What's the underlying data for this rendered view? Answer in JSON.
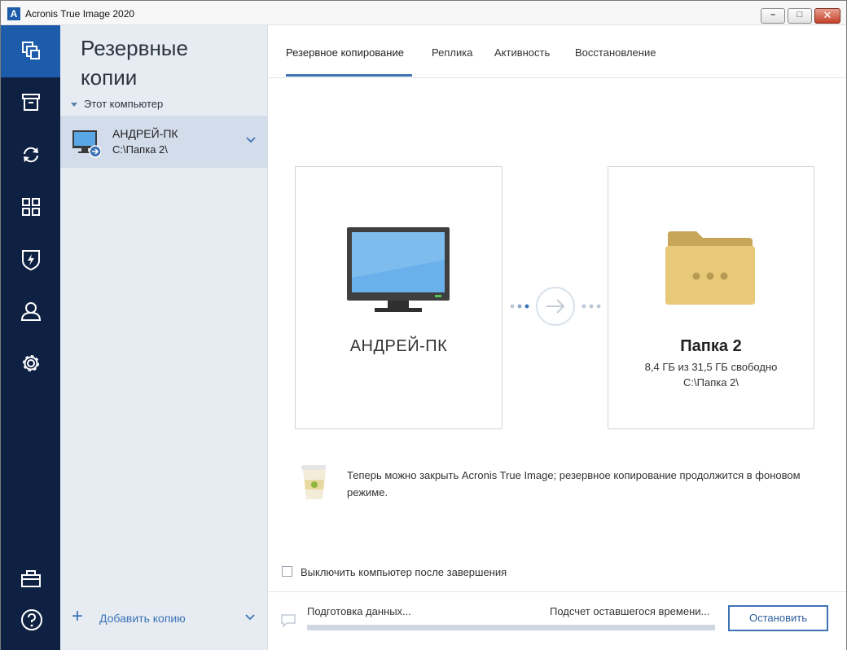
{
  "window": {
    "title": "Acronis True Image 2020",
    "logo_letter": "A",
    "controls": {
      "minimize": "–",
      "maximize": "□",
      "close": "✕"
    }
  },
  "rail": {
    "items": [
      "backup-icon",
      "archive-icon",
      "sync-icon",
      "tools-grid-icon",
      "shield-icon",
      "account-icon",
      "gear-icon",
      "store-icon",
      "help-icon"
    ],
    "active": "backup-icon"
  },
  "list": {
    "title": "Резервные копии",
    "group": "Этот компьютер",
    "item": {
      "name": "АНДРЕЙ-ПК",
      "path": "C:\\Папка 2\\"
    },
    "add_label": "Добавить копию"
  },
  "tabs": [
    "Резервное копирование",
    "Реплика",
    "Активность",
    "Восстановление"
  ],
  "active_tab": "Резервное копирование",
  "source": {
    "name": "АНДРЕЙ-ПК"
  },
  "destination": {
    "name": "Папка 2",
    "free": "8,4 ГБ из 31,5 ГБ свободно",
    "path": "C:\\Папка 2\\"
  },
  "notice": "Теперь можно закрыть Acronis True Image; резервное копирование продолжится в фоновом режиме.",
  "shutdown_label": "Выключить компьютер после завершения",
  "footer": {
    "status_left": "Подготовка данных...",
    "status_right": "Подсчет оставшегося времени...",
    "progress": 0,
    "stop_label": "Остановить"
  },
  "colors": {
    "rail": "#0f2143",
    "accent": "#1c5cab",
    "link": "#3d73b5",
    "list_bg": "#e7ecf3",
    "selected": "#d3dceb"
  }
}
